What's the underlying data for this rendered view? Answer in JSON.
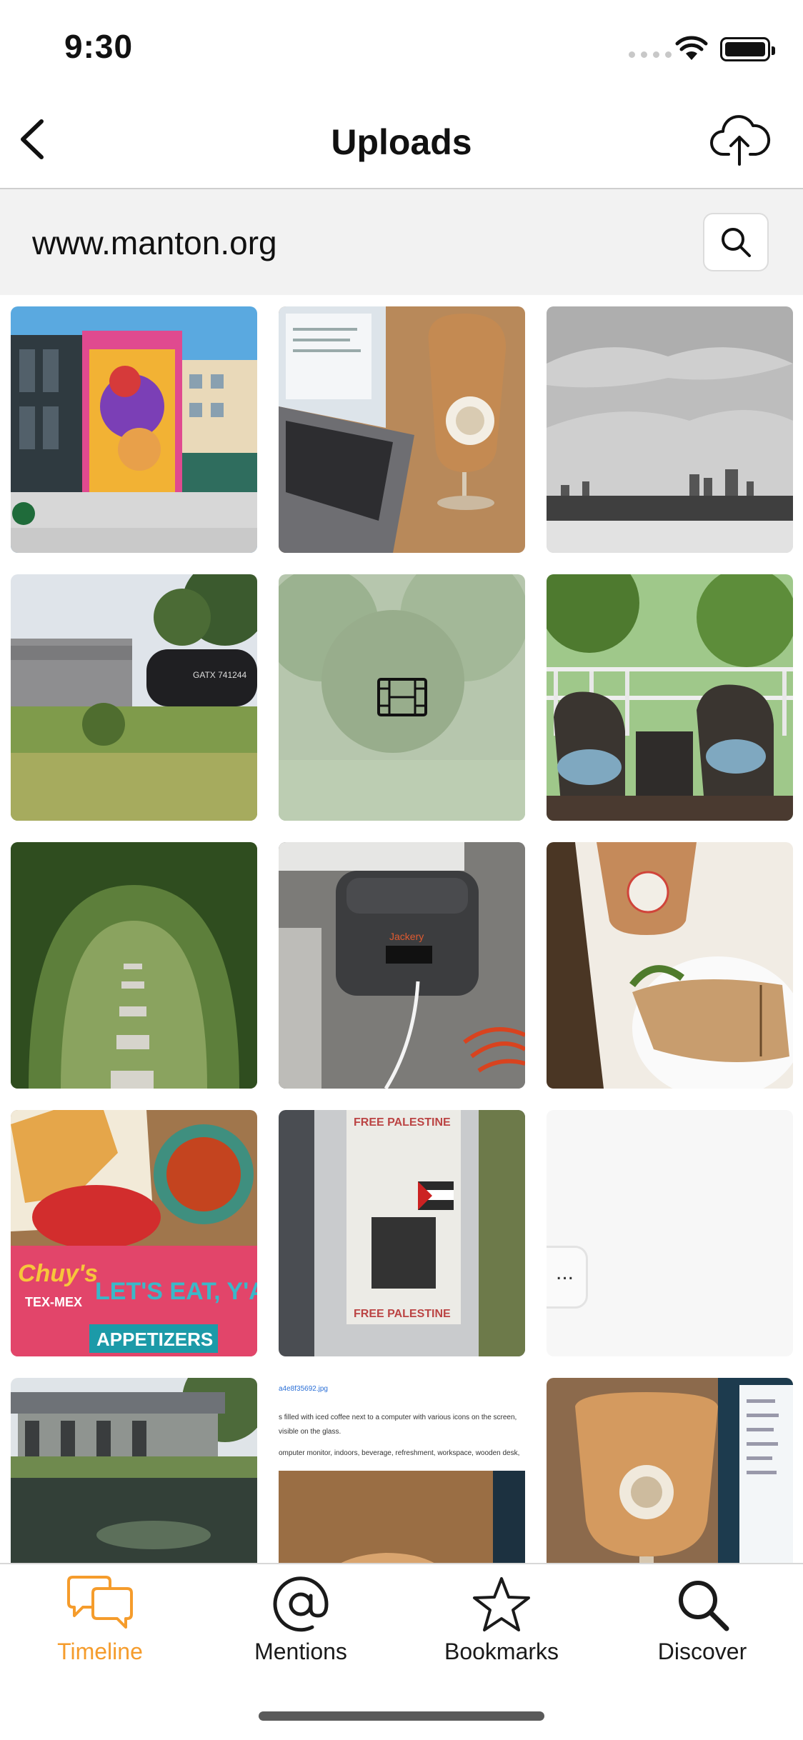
{
  "status_bar": {
    "time": "9:30"
  },
  "nav": {
    "title": "Uploads"
  },
  "site": {
    "domain": "www.manton.org"
  },
  "grid": {
    "tiles": [
      {
        "description": "Building mural"
      },
      {
        "description": "Iced coffee and laptop"
      },
      {
        "description": "Gray city skyline"
      },
      {
        "description": "Train in field"
      },
      {
        "description": "Video of trees"
      },
      {
        "description": "Porch chairs"
      },
      {
        "description": "Garden arch path"
      },
      {
        "description": "Portable power station"
      },
      {
        "description": "Iced coffee and sandwich"
      },
      {
        "description": "Chips and salsa with Chuy's menu"
      },
      {
        "description": "Pole with Free Palestine sticker"
      },
      {
        "description": "Loading placeholder"
      },
      {
        "description": "Pond and building"
      },
      {
        "description": "Screenshot of alt text"
      },
      {
        "description": "Iced coffee near monitor"
      }
    ],
    "tile_texts": {
      "chuys_logo": "Chuy's",
      "tex_mex": "TEX-MEX",
      "lets_eat": "LET'S EAT, Y'AL",
      "appetizers": "APPETIZERS",
      "free_palestine_top": "FREE PALESTINE",
      "free_palestine_bottom": "FREE PALESTINE",
      "jackery": "Jackery",
      "tanker": "GATX 741244",
      "screenshot_line1": "a4e8f35692.jpg",
      "screenshot_line2": "s filled with iced coffee next to a computer with various icons on the screen,",
      "screenshot_line3": "visible on the glass.",
      "screenshot_line4": "omputer monitor, indoors, beverage, refreshment, workspace, wooden desk,",
      "loading_dots": "..."
    }
  },
  "tabs": [
    {
      "label": "Timeline",
      "icon": "chat-bubbles-icon",
      "active": true
    },
    {
      "label": "Mentions",
      "icon": "at-sign-icon",
      "active": false
    },
    {
      "label": "Bookmarks",
      "icon": "star-icon",
      "active": false
    },
    {
      "label": "Discover",
      "icon": "search-icon",
      "active": false
    }
  ],
  "colors": {
    "accent": "#f59c2c",
    "site_bar_bg": "#f2f2f2"
  }
}
